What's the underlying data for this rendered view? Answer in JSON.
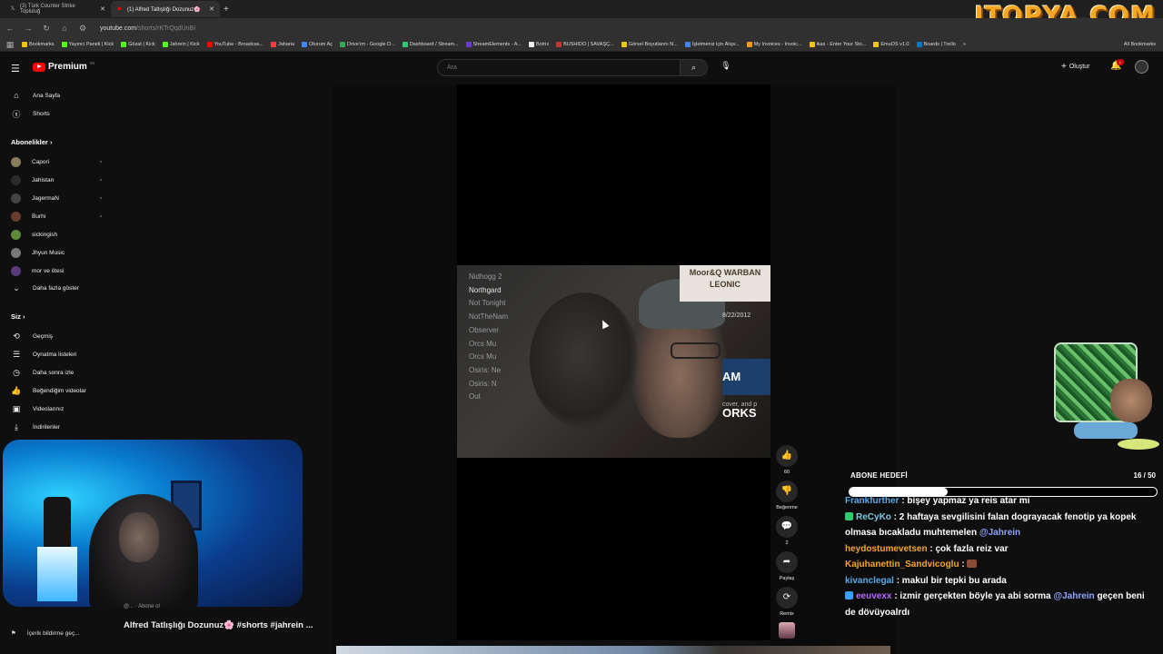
{
  "browser": {
    "tabs": [
      {
        "label": "(3) Türk Counter Strike Topluluğ",
        "active": false,
        "icon": "x-icon"
      },
      {
        "label": "(1) Alfred Tatlışlığı Dozunuz🌸",
        "active": true,
        "icon": "youtube-icon"
      }
    ],
    "new_tab": "+",
    "url_host": "youtube.com",
    "url_path": "/shorts/rKTrQqdUnBI",
    "bookmarks": [
      {
        "label": "Bookmarks",
        "color": "#f1c40f"
      },
      {
        "label": "Yayıncı Paneli | Kick",
        "color": "#53fc18"
      },
      {
        "label": "Gözat | Kick",
        "color": "#53fc18"
      },
      {
        "label": "Jahrein | Kick",
        "color": "#53fc18"
      },
      {
        "label": "YouTube - Broadcas...",
        "color": "#ff0000"
      },
      {
        "label": "Jaharia",
        "color": "#ff3b3b"
      },
      {
        "label": "Oturum Aç",
        "color": "#4285f4"
      },
      {
        "label": "Drive'ım - Google D...",
        "color": "#34a853"
      },
      {
        "label": "Dashboard / Stream...",
        "color": "#2ecc71"
      },
      {
        "label": "StreamElements - A...",
        "color": "#6c3bd1"
      },
      {
        "label": "Botrix",
        "color": "#eeeeee"
      },
      {
        "label": "BUSHIDO | SAVAŞÇ...",
        "color": "#c0392b"
      },
      {
        "label": "Görsel Boyutlarını N...",
        "color": "#f1c40f"
      },
      {
        "label": "İşletmeniz için Alışv...",
        "color": "#4285f4"
      },
      {
        "label": "My Invoices - Invoic...",
        "color": "#f39c12"
      },
      {
        "label": "ikas - Enter Your Sto...",
        "color": "#f1c40f"
      },
      {
        "label": "EmuOS v1.0",
        "color": "#f1c40f"
      },
      {
        "label": "Boards | Trello",
        "color": "#0079bf"
      }
    ],
    "all_bookmarks": "All Bookmarks"
  },
  "overlay_logo": "ITOPYA.COM",
  "youtube": {
    "logo_text": "Premium",
    "logo_tr": "TR",
    "search_placeholder": "Ara",
    "create_label": "Oluştur",
    "notification_count": "1"
  },
  "sidebar": {
    "home": "Ana Sayfa",
    "shorts": "Shorts",
    "subscriptions_title": "Abonelikler",
    "subscriptions": [
      {
        "name": "Capori",
        "color": "#8a7b5c"
      },
      {
        "name": "Jahistan",
        "color": "#2b2b2b"
      },
      {
        "name": "JagermaN",
        "color": "#444444"
      },
      {
        "name": "Burhi",
        "color": "#6b3b2b"
      },
      {
        "name": "sickingish",
        "color": "#5e8a3a"
      },
      {
        "name": "Jhyun Music",
        "color": "#777777"
      },
      {
        "name": "mor ve ötesi",
        "color": "#5a3a7a"
      }
    ],
    "show_more": "Daha fazla göster",
    "you_title": "Siz",
    "you_items": [
      {
        "label": "Geçmiş",
        "icon": "history-icon"
      },
      {
        "label": "Oynatma listeleri",
        "icon": "playlist-icon"
      },
      {
        "label": "Daha sonra izle",
        "icon": "clock-icon"
      },
      {
        "label": "Beğendiğim videolar",
        "icon": "thumbs-up-icon"
      },
      {
        "label": "Videolarınız",
        "icon": "video-icon"
      },
      {
        "label": "İndirilenler",
        "icon": "download-icon"
      }
    ],
    "feedback": "İçerik bildirme geç..."
  },
  "video": {
    "menu_items": [
      "Nidhogg 2",
      "Northgard",
      "Not Tonight",
      "NotTheNam",
      "Observer",
      "Orcs Mu",
      "Orcs Mu",
      "Osiris: Ne",
      "Osiris: N",
      "Out"
    ],
    "highlighted_index": 1,
    "banner_text": "Moor&Q WARBAN LEONIC",
    "date_text": "8/22/2012",
    "works_text": "AM ORKS",
    "caption_text": "cover, and p"
  },
  "actions": {
    "like_count": "60",
    "dislike_label": "Beğenme",
    "comment_count": "2",
    "share_label": "Paylaş",
    "remix_label": "Remix"
  },
  "below": {
    "channel": "@...   · Abone ol",
    "title": "Alfred Tatlışlığı Dozunuz🌸 #shorts #jahrein ..."
  },
  "stream": {
    "goal_label": "ABONE HEDEFİ",
    "goal_count": "16 / 50",
    "goal_progress": 0.32,
    "chat": [
      {
        "user": "Frankfurther",
        "color": "#5aa9e6",
        "badge": null,
        "parts": [
          {
            "t": " : bişey yapmaz ya reis atar mi"
          }
        ]
      },
      {
        "user": "ReCyKo",
        "color": "#7ec8e3",
        "badge": "#2ecc71",
        "parts": [
          {
            "t": " : 2 haftaya sevgilisini falan dograyacak fenotip ya kopek olmasa bıcakladu muhtemelen "
          },
          {
            "t": "@Jahrein",
            "m": true
          }
        ]
      },
      {
        "user": "heydostumevetsen",
        "color": "#f5a623",
        "badge": null,
        "parts": [
          {
            "t": " : çok fazla reiz var"
          }
        ]
      },
      {
        "user": "Kajuhanettin_Sandvicoglu",
        "color": "#f5a623",
        "badge": null,
        "parts": [
          {
            "t": " : "
          }
        ],
        "emote": true
      },
      {
        "user": "kivanclegal",
        "color": "#5aa9e6",
        "badge": null,
        "parts": [
          {
            "t": " : makul bir tepki bu arada"
          }
        ]
      },
      {
        "user": "eeuvexx",
        "color": "#b967ff",
        "badge": "#3aa0ff",
        "parts": [
          {
            "t": " : izmir gerçekten böyle ya abi sorma "
          },
          {
            "t": "@Jahrein",
            "m": true
          },
          {
            "t": " geçen beni de dövüyoalrdı"
          }
        ]
      }
    ]
  }
}
